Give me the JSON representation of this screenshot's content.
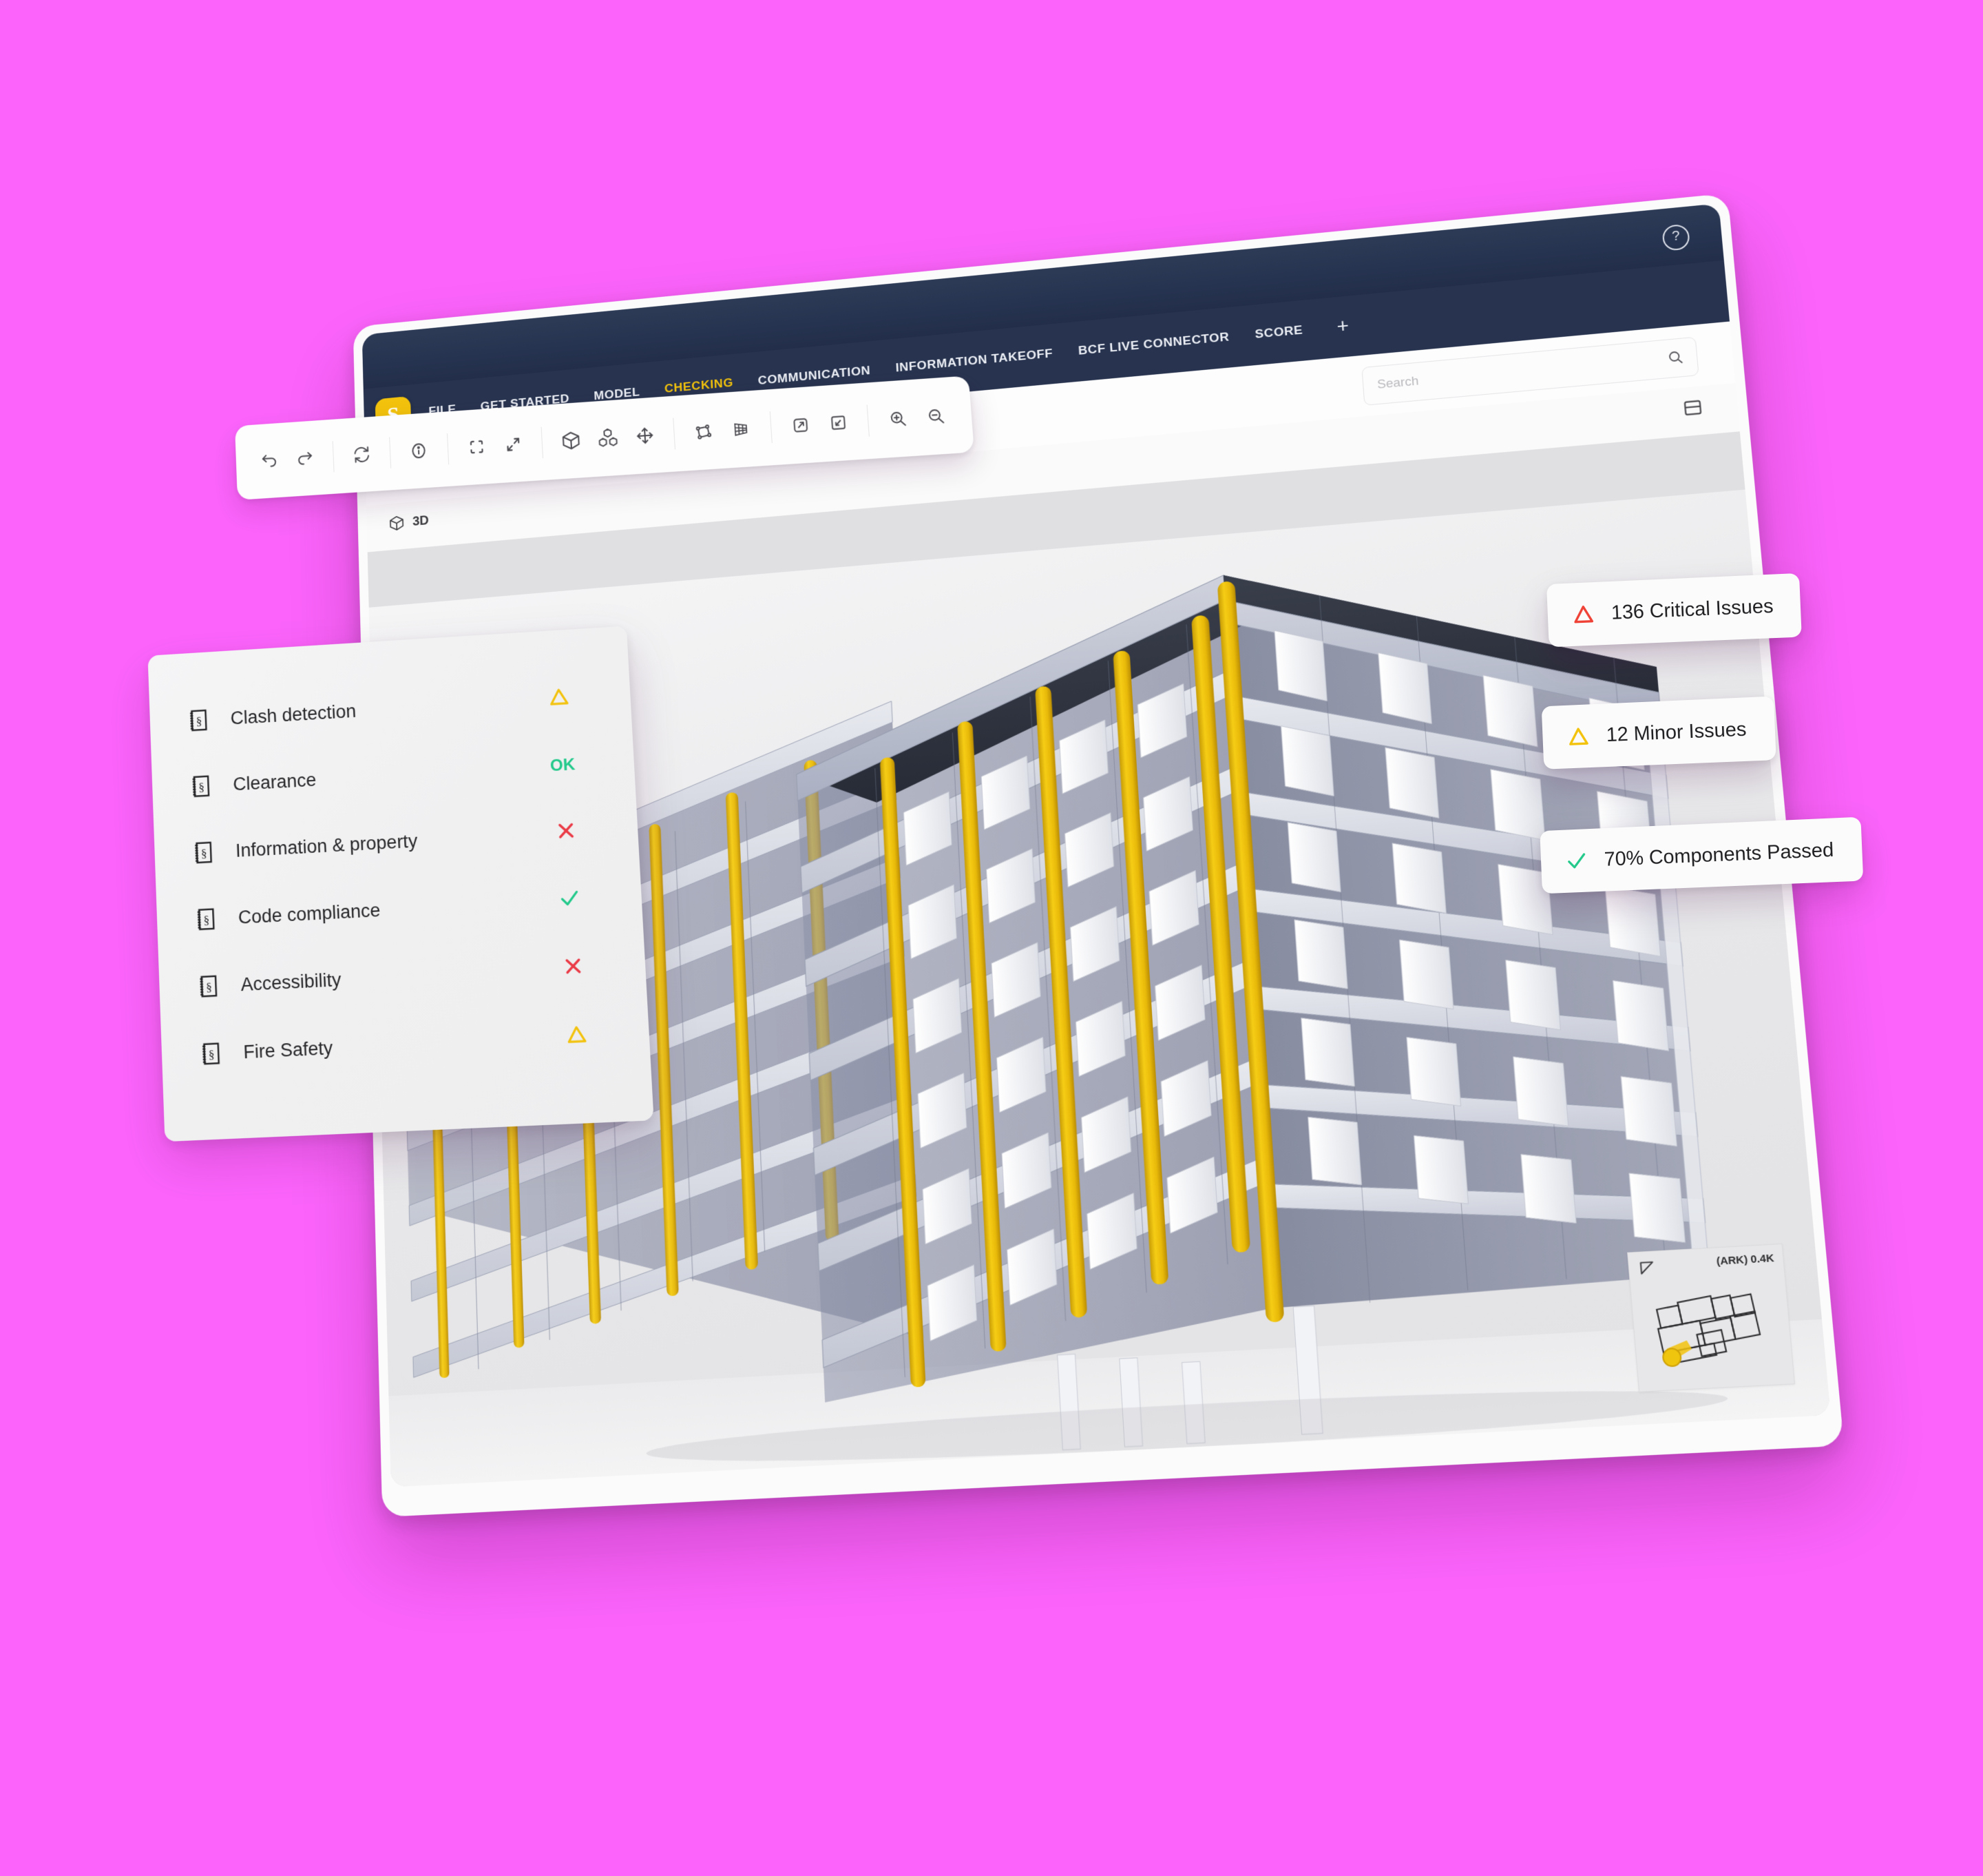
{
  "background_color": "#fc63fb",
  "app": {
    "logo_letter": "S",
    "logo_color": "#f2c20c",
    "titlebar_color": "#27334f",
    "help_icon": "question-mark-icon"
  },
  "menu": {
    "items": [
      {
        "label": "FILE",
        "active": false
      },
      {
        "label": "GET STARTED",
        "active": false
      },
      {
        "label": "MODEL",
        "active": false
      },
      {
        "label": "CHECKING",
        "active": true
      },
      {
        "label": "COMMUNICATION",
        "active": false
      },
      {
        "label": "INFORMATION TAKEOFF",
        "active": false
      },
      {
        "label": "BCF LIVE CONNECTOR",
        "active": false
      },
      {
        "label": "SCORE",
        "active": false
      }
    ],
    "add_tab_label": "+",
    "active_color": "#f2c20c"
  },
  "search": {
    "placeholder": "Search",
    "value": "",
    "icon": "search-icon"
  },
  "toolbar": {
    "groups": [
      [
        "undo-icon",
        "redo-icon"
      ],
      [
        "refresh-icon"
      ],
      [
        "info-icon"
      ],
      [
        "select-box-icon",
        "fullscreen-expand-icon"
      ],
      [
        "cube-icon",
        "cubes-group-icon",
        "move-pan-icon"
      ],
      [
        "polygon-select-icon",
        "mesh-grid-icon"
      ],
      [
        "layers-icon",
        "panel-snap-icon"
      ],
      [
        "zoom-in-icon",
        "zoom-out-icon"
      ]
    ]
  },
  "viewport": {
    "mode_icon": "cube-icon",
    "mode_label": "3D",
    "panel_toggle_icon": "panel-layout-icon",
    "minimap": {
      "label": "(ARK) 0.4K",
      "corner_icon": "view-cone-icon"
    }
  },
  "check_panel": {
    "rows": [
      {
        "icon": "section-document-icon",
        "label": "Clash detection",
        "status": "warning",
        "status_text": "△",
        "color": "#f2c20c"
      },
      {
        "icon": "section-document-icon",
        "label": "Clearance",
        "status": "ok",
        "status_text": "OK",
        "color": "#22c98a"
      },
      {
        "icon": "section-document-icon",
        "label": "Information & property",
        "status": "fail",
        "status_text": "✕",
        "color": "#ea3b46"
      },
      {
        "icon": "section-document-icon",
        "label": "Code compliance",
        "status": "pass",
        "status_text": "✓",
        "color": "#22c98a"
      },
      {
        "icon": "section-document-icon",
        "label": "Accessibility",
        "status": "fail",
        "status_text": "✕",
        "color": "#ea3b46"
      },
      {
        "icon": "section-document-icon",
        "label": "Fire Safety",
        "status": "warning",
        "status_text": "△",
        "color": "#f2c20c"
      }
    ]
  },
  "badges": [
    {
      "icon": "warning-triangle-icon",
      "color": "#ef4136",
      "label": "136 Critical Issues"
    },
    {
      "icon": "warning-triangle-icon",
      "color": "#f2c20c",
      "label": "12 Minor Issues"
    },
    {
      "icon": "check-icon",
      "color": "#22c98a",
      "label": "70% Components Passed"
    }
  ]
}
